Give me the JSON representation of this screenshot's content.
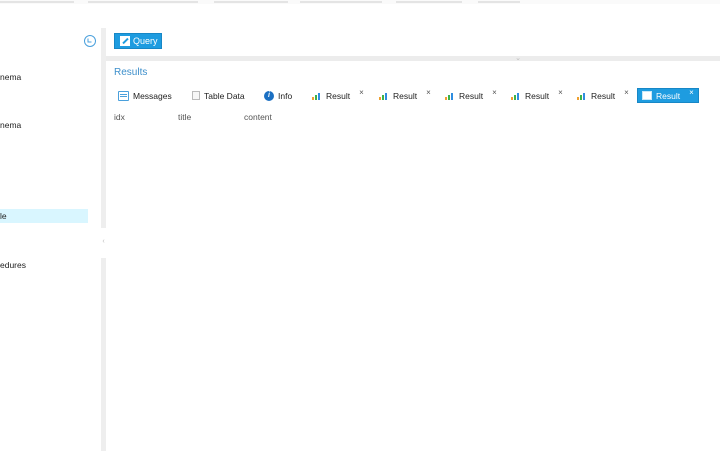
{
  "sidebar": {
    "items": [
      {
        "label": "nema",
        "selected": false
      },
      {
        "label": "nema",
        "selected": false
      },
      {
        "label": "le",
        "selected": true
      },
      {
        "label": "edures",
        "selected": false
      }
    ]
  },
  "toolbar": {
    "query_label": "Query"
  },
  "results": {
    "title": "Results",
    "tabs": [
      {
        "label": "Messages",
        "icon": "message-icon",
        "closable": false,
        "active": false
      },
      {
        "label": "Table Data",
        "icon": "table-icon",
        "closable": false,
        "active": false
      },
      {
        "label": "Info",
        "icon": "info-icon",
        "closable": false,
        "active": false
      },
      {
        "label": "Result",
        "icon": "chart-icon",
        "closable": true,
        "active": false
      },
      {
        "label": "Result",
        "icon": "chart-icon",
        "closable": true,
        "active": false
      },
      {
        "label": "Result",
        "icon": "chart-icon",
        "closable": true,
        "active": false
      },
      {
        "label": "Result",
        "icon": "chart-icon",
        "closable": true,
        "active": false
      },
      {
        "label": "Result",
        "icon": "chart-icon",
        "closable": true,
        "active": false
      },
      {
        "label": "Result",
        "icon": "result-icon",
        "closable": true,
        "active": true
      }
    ],
    "close_glyph": "×",
    "columns": [
      "idx",
      "title",
      "content"
    ]
  },
  "colors": {
    "accent": "#1e9ce0",
    "selected_row": "#d9f6ff",
    "results_title": "#3d8fcb"
  }
}
